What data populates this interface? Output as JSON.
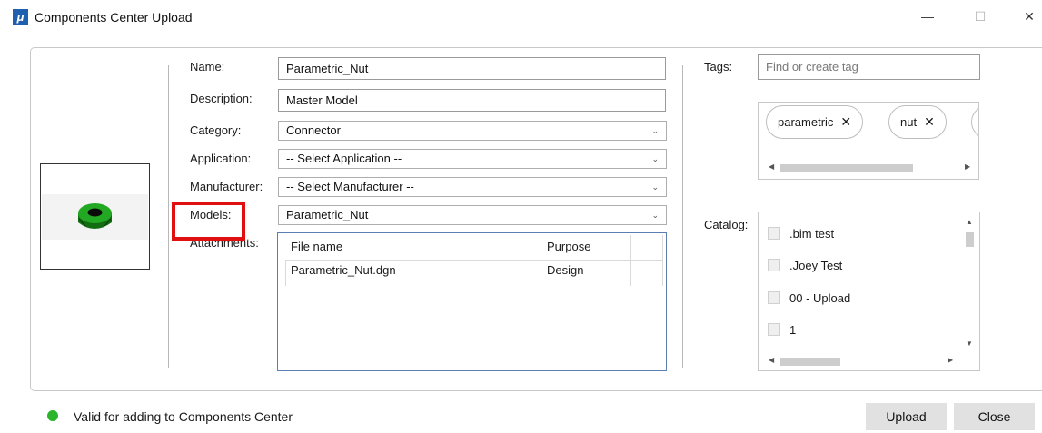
{
  "window": {
    "title": "Components Center Upload",
    "icon_glyph": "μ",
    "minimize_glyph": "—",
    "maximize_glyph": "☐",
    "close_glyph": "✕"
  },
  "form": {
    "name_label": "Name:",
    "name_value": "Parametric_Nut",
    "description_label": "Description:",
    "description_value": "Master Model",
    "category_label": "Category:",
    "category_value": "Connector",
    "application_label": "Application:",
    "application_value": "-- Select Application --",
    "manufacturer_label": "Manufacturer:",
    "manufacturer_value": "-- Select Manufacturer --",
    "models_label": "Models:",
    "models_value": "Parametric_Nut",
    "attachments_label": "Attachments:"
  },
  "attachments": {
    "columns": [
      "File name",
      "Purpose"
    ],
    "rows": [
      [
        "Parametric_Nut.dgn",
        "Design"
      ]
    ]
  },
  "tags": {
    "label": "Tags:",
    "placeholder": "Find or create tag",
    "chips": [
      {
        "label": "parametric",
        "remove": "✕"
      },
      {
        "label": "nut",
        "remove": "✕"
      }
    ]
  },
  "catalog": {
    "label": "Catalog:",
    "items": [
      ".bim test",
      ".Joey Test",
      "00 - Upload",
      "1"
    ]
  },
  "status": {
    "text": "Valid for adding to Components Center",
    "color": "#2db42d"
  },
  "buttons": {
    "upload": "Upload",
    "close": "Close"
  },
  "colors": {
    "highlight": "#e01010",
    "nut": "#1fa51f"
  }
}
